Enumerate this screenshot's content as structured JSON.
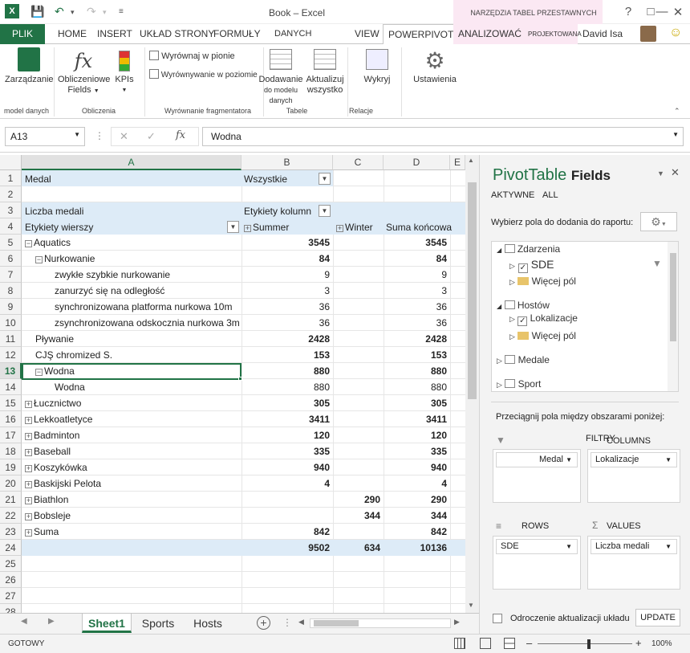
{
  "window": {
    "title": "Book – Excel",
    "context_tools": "NARZĘDZIA TABEL PRZESTAWNYCH",
    "user": "David Isa"
  },
  "tabs": {
    "file": "PLIK",
    "items": [
      "HOME",
      "INSERT",
      "UKŁAD STRONY",
      "FORMUŁY",
      "DANYCH",
      "VIEW",
      "POWERPIVOT",
      "ANALIZOWAĆ",
      "PROJEKTOWANA"
    ]
  },
  "ribbon": {
    "manage": "Zarządzanie",
    "calc_fields": "Obliczeniowe",
    "calc_fields2": "Fields",
    "kpis": "KPIs",
    "align_vertical": "Wyrównaj w pionie",
    "align_horizontal": "Wyrównywanie w poziomie",
    "add_to_model": "Dodawanie",
    "add_to_model2": "do modelu danych",
    "update_all": "Aktualizuj",
    "update_all2": "wszystko",
    "detect": "Wykryj",
    "settings": "Ustawienia",
    "groups": {
      "data_model": "model danych",
      "calculations": "Obliczenia",
      "slicer_alignment": "Wyrównanie fragmentatora",
      "tables": "Tabele",
      "relations": "Relacje"
    }
  },
  "formula_bar": {
    "name_box": "A13",
    "formula": "Wodna"
  },
  "columns": [
    "A",
    "B",
    "C",
    "D",
    "E"
  ],
  "rows": {
    "numbers": [
      "1",
      "2",
      "3",
      "4",
      "5",
      "6",
      "7",
      "8",
      "9",
      "10",
      "11",
      "12",
      "13",
      "14",
      "15",
      "16",
      "17",
      "18",
      "19",
      "20",
      "21",
      "22",
      "23",
      "24",
      "25",
      "26",
      "27",
      "28"
    ],
    "r1": {
      "a": "Medal",
      "b": "Wszystkie"
    },
    "r3": {
      "a": "Liczba medali",
      "b": "Etykiety kolumn"
    },
    "r4": {
      "a": "Etykiety wierszy",
      "b": "Summer",
      "c": "Winter",
      "d": "Suma końcowa"
    },
    "data": [
      {
        "label": "Aquatics",
        "summer": "3545",
        "winter": "",
        "total": "3545"
      },
      {
        "label": "Nurkowanie",
        "summer": "84",
        "winter": "",
        "total": "84"
      },
      {
        "label": "zwykłe szybkie nurkowanie",
        "summer": "9",
        "winter": "",
        "total": "9"
      },
      {
        "label": "zanurzyć się na odległość",
        "summer": "3",
        "winter": "",
        "total": "3"
      },
      {
        "label": "synchronizowana platforma nurkowa 10m",
        "summer": "36",
        "winter": "",
        "total": "36"
      },
      {
        "label": "zsynchronizowana odskocznia nurkowa 3m",
        "summer": "36",
        "winter": "",
        "total": "36"
      },
      {
        "label": "Pływanie",
        "summer": "2428",
        "winter": "",
        "total": "2428"
      },
      {
        "label": "CJŞ chromized S.",
        "summer": "153",
        "winter": "",
        "total": "153"
      },
      {
        "label": "Wodna",
        "summer": "880",
        "winter": "",
        "total": "880"
      },
      {
        "label": "Wodna",
        "summer": "880",
        "winter": "",
        "total": "880"
      },
      {
        "label": "Łucznictwo",
        "summer": "305",
        "winter": "",
        "total": "305"
      },
      {
        "label": "Lekkoatletyce",
        "summer": "3411",
        "winter": "",
        "total": "3411"
      },
      {
        "label": "Badminton",
        "summer": "120",
        "winter": "",
        "total": "120"
      },
      {
        "label": "Baseball",
        "summer": "335",
        "winter": "",
        "total": "335"
      },
      {
        "label": "Koszykówka",
        "summer": "940",
        "winter": "",
        "total": "940"
      },
      {
        "label": "Baskijski Pelota",
        "summer": "4",
        "winter": "",
        "total": "4"
      },
      {
        "label": "Biathlon",
        "summer": "",
        "winter": "290",
        "total": "290"
      },
      {
        "label": "Bobsleje",
        "summer": "",
        "winter": "344",
        "total": "344"
      },
      {
        "label": "Suma",
        "summer": "842",
        "winter": "",
        "total": "842"
      },
      {
        "label": "",
        "summer": "9502",
        "winter": "634",
        "total": "10136"
      }
    ]
  },
  "sheets": [
    "Sheet1",
    "Sports",
    "Hosts"
  ],
  "pane": {
    "title_a": "PivotTable",
    "title_b": "Fields",
    "tab_active": "AKTYWNE",
    "tab_all": "ALL",
    "choose_label": "Wybierz pola do dodania do raportu:",
    "fields": {
      "events": "Zdarzenia",
      "sde": "SDE",
      "more1": "Więcej pól",
      "hosts": "Hostów",
      "locations": "Lokalizacje",
      "more2": "Więcej pól",
      "medals": "Medale",
      "sport": "Sport"
    },
    "drag_label": "Przeciągnij pola między obszarami poniżej:",
    "filters_label": "FILTRY",
    "columns_label": "COLUMNS",
    "rows_label": "ROWS",
    "values_label": "VALUES",
    "filter_item": "Medal",
    "column_item": "Lokalizacje",
    "row_item": "SDE",
    "value_item": "Liczba medali",
    "defer_label": "Odroczenie aktualizacji układu",
    "update_button": "UPDATE"
  },
  "status": {
    "ready": "GOTOWY",
    "zoom": "100%"
  },
  "colors": {
    "excel_green": "#217346",
    "pivot_header_blue": "#ddebf7",
    "context_pink": "#fbe8f3"
  }
}
